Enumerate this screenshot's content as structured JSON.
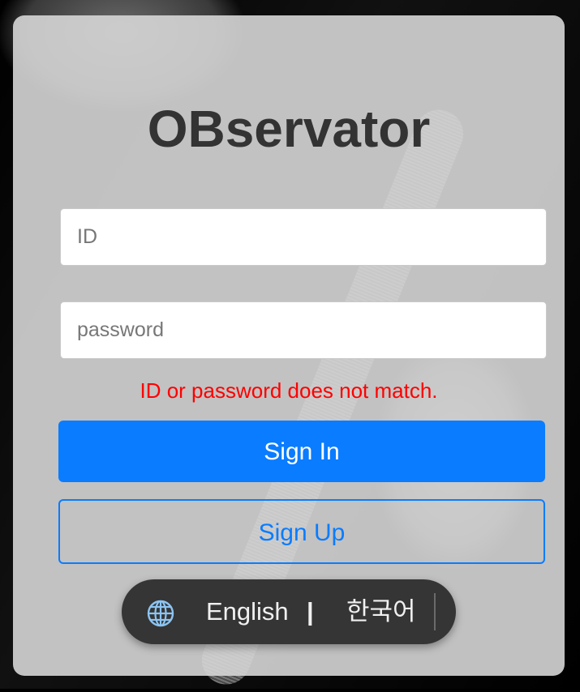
{
  "app": {
    "title": "OBservator"
  },
  "login": {
    "id_placeholder": "ID",
    "password_placeholder": "password",
    "error_message": "ID or password does not match.",
    "sign_in_label": "Sign In",
    "sign_up_label": "Sign Up"
  },
  "language": {
    "icon": "globe-icon",
    "options": [
      "English",
      "한국어"
    ],
    "separator": "|"
  },
  "colors": {
    "accent": "#0a7cff",
    "error": "#ff0000",
    "title": "#333333",
    "language_bar": "#353535"
  }
}
